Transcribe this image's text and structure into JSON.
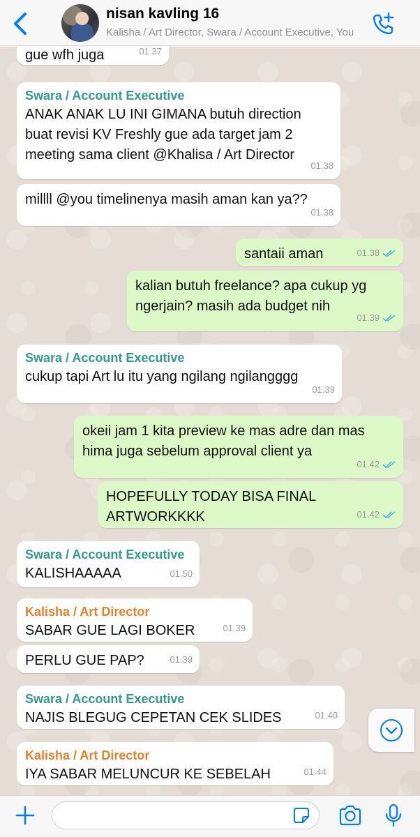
{
  "header": {
    "title": "nisan kavling 16",
    "subtitle": "Kalisha / Art Director, Swara / Account Executive, You",
    "back_icon": "chevron-left-icon",
    "call_icon": "add-call-icon"
  },
  "colors": {
    "accent": "#007aff",
    "incoming_bubble": "#ffffff",
    "outgoing_bubble": "#dcf8c6",
    "sender_swara": "#34998f",
    "sender_kalisha": "#e6812e",
    "read_ticks": "#4fb6ec",
    "chat_background": "#e5ddd5"
  },
  "messages": [
    {
      "direction": "in",
      "sender": "",
      "text": "gue wfh juga",
      "time": "01.37"
    },
    {
      "direction": "in",
      "sender": "Swara / Account Executive",
      "text": "ANAK ANAK LU INI GIMANA butuh direction\nbuat revisi KV Freshly gue ada target jam 2\nmeeting sama client @Khalisa / Art Director",
      "time": "01.38"
    },
    {
      "direction": "in",
      "sender": "",
      "text": "millll @you timelinenya masih aman kan ya??",
      "time": "01.38"
    },
    {
      "direction": "out",
      "sender": "",
      "text": "santaii aman",
      "time": "01.38",
      "status": "read"
    },
    {
      "direction": "out",
      "sender": "",
      "text": "kalian butuh freelance? apa cukup yg\nngerjain? masih ada budget nih",
      "time": "01.39",
      "status": "read"
    },
    {
      "direction": "in",
      "sender": "Swara / Account Executive",
      "text": "cukup tapi Art lu itu yang ngilang ngilangggg",
      "time": "01.39"
    },
    {
      "direction": "out",
      "sender": "",
      "text": "okeii jam 1 kita preview ke mas adre dan mas\nhima juga sebelum approval client ya",
      "time": "01.42",
      "status": "read"
    },
    {
      "direction": "out",
      "sender": "",
      "text": "HOPEFULLY TODAY BISA FINAL\nARTWORKKKK",
      "time": "01.42",
      "status": "read"
    },
    {
      "direction": "in",
      "sender": "Swara / Account Executive",
      "text": "KALISHAAAAA",
      "time": "01.50"
    },
    {
      "direction": "in",
      "sender": "Kalisha / Art Director",
      "text": "SABAR GUE LAGI BOKER",
      "time": "01.39"
    },
    {
      "direction": "in",
      "sender": "",
      "text": "PERLU GUE PAP?",
      "time": "01.39"
    },
    {
      "direction": "in",
      "sender": "Swara / Account Executive",
      "text": "NAJIS BLEGUG CEPETAN CEK SLIDES",
      "time": "01.40"
    },
    {
      "direction": "in",
      "sender": "Kalisha / Art Director",
      "text": "IYA SABAR MELUNCUR KE SEBELAH",
      "time": "01.44"
    }
  ],
  "input": {
    "value": "",
    "placeholder": ""
  },
  "icons": {
    "plus": "plus-icon",
    "sticker": "sticker-icon",
    "camera": "camera-icon",
    "mic": "microphone-icon",
    "scroll_down": "chevron-down-circle-icon"
  }
}
